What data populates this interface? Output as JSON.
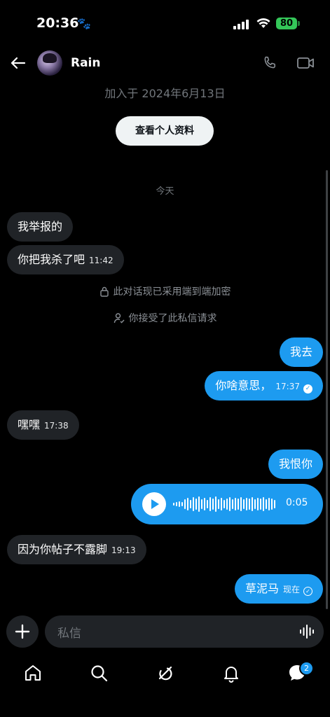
{
  "status_bar": {
    "time": "20:36",
    "battery": "80"
  },
  "header": {
    "contact_name": "Rain"
  },
  "profile": {
    "joined_text": "加入于 2024年6月13日",
    "view_profile_label": "查看个人资料"
  },
  "day_separator": "今天",
  "messages": [
    {
      "dir": "in",
      "text": "我举报的",
      "time": ""
    },
    {
      "dir": "in",
      "text": "你把我杀了吧",
      "time": "11:42"
    },
    {
      "dir": "system",
      "text": "此对话现已采用端到端加密"
    },
    {
      "dir": "system",
      "text": "你接受了此私信请求"
    },
    {
      "dir": "out",
      "text": "我去",
      "time": ""
    },
    {
      "dir": "out",
      "text": "你啥意思，",
      "time": "17:37"
    },
    {
      "dir": "in",
      "text": "嘿嘿",
      "time": "17:38"
    },
    {
      "dir": "out",
      "text": "我恨你",
      "time": ""
    },
    {
      "dir": "out-voice",
      "duration": "0:05"
    },
    {
      "dir": "in",
      "text": "因为你帖子不露脚",
      "time": "19:13"
    },
    {
      "dir": "out",
      "text": "草泥马",
      "time": "现在"
    }
  ],
  "composer": {
    "placeholder": "私信"
  },
  "tab_bar": {
    "messages_badge": "2"
  },
  "colors": {
    "accent": "#1d9bf0",
    "incoming_bubble": "#202327",
    "background": "#000000"
  }
}
